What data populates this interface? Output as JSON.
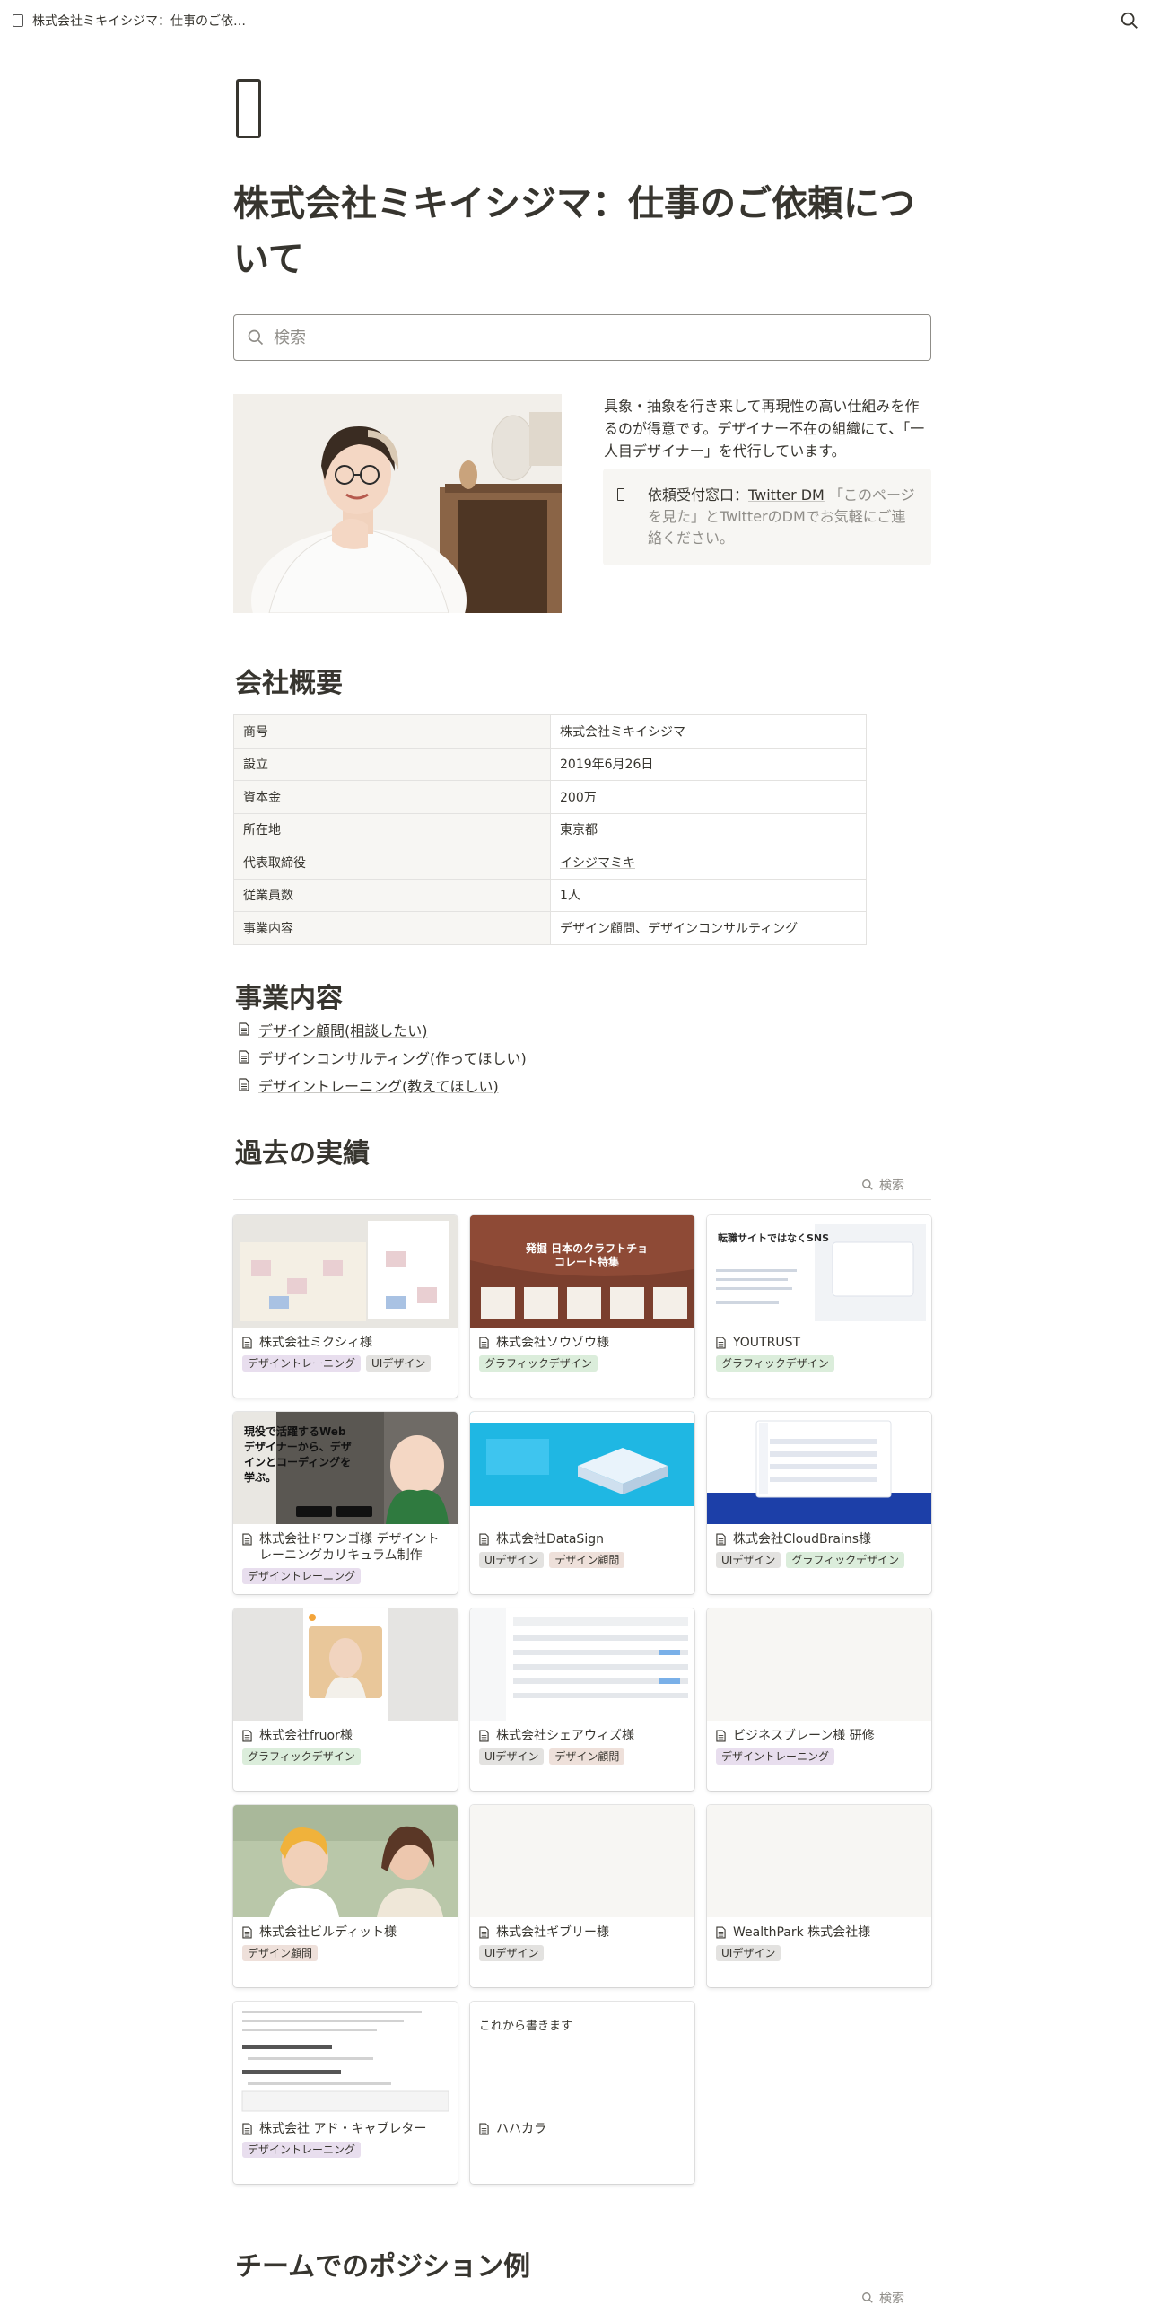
{
  "topbar": {
    "breadcrumb": "株式会社ミキイシジマ：仕事のご依…"
  },
  "page": {
    "title": "株式会社ミキイシジマ：仕事のご依頼について",
    "search_placeholder": "検索",
    "intro": "具象・抽象を行き来して再現性の高い仕組みを作るのが得意です。デザイナー不在の組織にて、「一人目デザイナー」を代行しています。",
    "callout": {
      "lead": "依頼受付窓口：",
      "link": "Twitter DM",
      "rest": "「このページを見た」とTwitterのDMでお気軽にご連絡ください。"
    }
  },
  "company": {
    "heading": "会社概要",
    "rows": [
      {
        "key": "商号",
        "value": "株式会社ミキイシジマ"
      },
      {
        "key": "設立",
        "value": "2019年6月26日"
      },
      {
        "key": "資本金",
        "value": "200万"
      },
      {
        "key": "所在地",
        "value": "東京都"
      },
      {
        "key": "代表取締役",
        "value": "イシジマミキ"
      },
      {
        "key": "従業員数",
        "value": "1人"
      },
      {
        "key": "事業内容",
        "value": "デザイン顧問、デザインコンサルティング"
      }
    ]
  },
  "business": {
    "heading": "事業内容",
    "links": [
      "デザイン顧問(相談したい)",
      "デザインコンサルティング(作ってほしい)",
      "デザイントレーニング(教えてほしい)"
    ]
  },
  "works": {
    "heading": "過去の実績",
    "search_label": "検索",
    "cards": [
      {
        "name": "株式会社ミクシィ様",
        "tags": [
          {
            "label": "デザイントレーニング",
            "color": "purple"
          },
          {
            "label": "UIデザイン",
            "color": "gray"
          }
        ]
      },
      {
        "name": "株式会社ソウゾウ様",
        "tags": [
          {
            "label": "グラフィックデザイン",
            "color": "green"
          }
        ],
        "cover_text": "発掘 日本のクラフトチョコレート特集"
      },
      {
        "name": "YOUTRUST",
        "tags": [
          {
            "label": "グラフィックデザイン",
            "color": "green"
          }
        ],
        "cover_text": "転職サイトではなくSNS"
      },
      {
        "name": "株式会社ドワンゴ様 デザイントレーニングカリキュラム制作",
        "tags": [
          {
            "label": "デザイントレーニング",
            "color": "purple"
          }
        ],
        "cover_text": "現役で活躍するWebデザイナーから、デザインとコーディングを学ぶ。"
      },
      {
        "name": "株式会社DataSign",
        "tags": [
          {
            "label": "UIデザイン",
            "color": "gray"
          },
          {
            "label": "デザイン顧問",
            "color": "brown"
          }
        ]
      },
      {
        "name": "株式会社CloudBrains様",
        "tags": [
          {
            "label": "UIデザイン",
            "color": "gray"
          },
          {
            "label": "グラフィックデザイン",
            "color": "green"
          }
        ]
      },
      {
        "name": "株式会社fruor様",
        "tags": [
          {
            "label": "グラフィックデザイン",
            "color": "green"
          }
        ]
      },
      {
        "name": "株式会社シェアウィズ様",
        "tags": [
          {
            "label": "UIデザイン",
            "color": "gray"
          },
          {
            "label": "デザイン顧問",
            "color": "brown"
          }
        ]
      },
      {
        "name": "ビジネスブレーン様 研修",
        "tags": [
          {
            "label": "デザイントレーニング",
            "color": "purple"
          }
        ]
      },
      {
        "name": "株式会社ビルディット様",
        "tags": [
          {
            "label": "デザイン顧問",
            "color": "brown"
          }
        ]
      },
      {
        "name": "株式会社ギブリー様",
        "tags": [
          {
            "label": "UIデザイン",
            "color": "gray"
          }
        ]
      },
      {
        "name": "WealthPark 株式会社様",
        "tags": [
          {
            "label": "UIデザイン",
            "color": "gray"
          }
        ]
      },
      {
        "name": "株式会社 アド・キャブレター",
        "tags": [
          {
            "label": "デザイントレーニング",
            "color": "purple"
          }
        ]
      },
      {
        "name": "ハハカラ",
        "tags": [],
        "cover_text": "これから書きます"
      }
    ]
  },
  "team": {
    "heading": "チームでのポジション例",
    "search_label": "検索"
  }
}
